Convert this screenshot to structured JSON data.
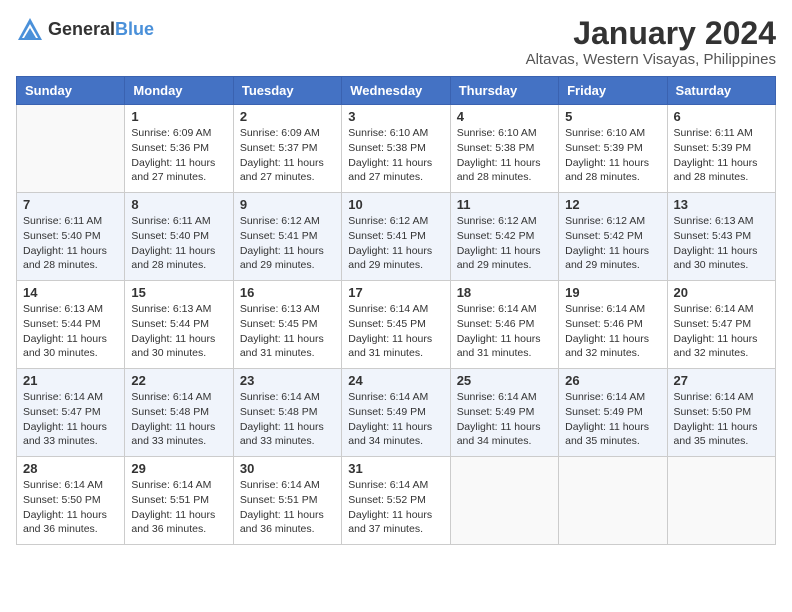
{
  "logo": {
    "general": "General",
    "blue": "Blue"
  },
  "title": "January 2024",
  "location": "Altavas, Western Visayas, Philippines",
  "days_header": [
    "Sunday",
    "Monday",
    "Tuesday",
    "Wednesday",
    "Thursday",
    "Friday",
    "Saturday"
  ],
  "weeks": [
    [
      {
        "day": "",
        "sunrise": "",
        "sunset": "",
        "daylight": ""
      },
      {
        "day": "1",
        "sunrise": "Sunrise: 6:09 AM",
        "sunset": "Sunset: 5:36 PM",
        "daylight": "Daylight: 11 hours and 27 minutes."
      },
      {
        "day": "2",
        "sunrise": "Sunrise: 6:09 AM",
        "sunset": "Sunset: 5:37 PM",
        "daylight": "Daylight: 11 hours and 27 minutes."
      },
      {
        "day": "3",
        "sunrise": "Sunrise: 6:10 AM",
        "sunset": "Sunset: 5:38 PM",
        "daylight": "Daylight: 11 hours and 27 minutes."
      },
      {
        "day": "4",
        "sunrise": "Sunrise: 6:10 AM",
        "sunset": "Sunset: 5:38 PM",
        "daylight": "Daylight: 11 hours and 28 minutes."
      },
      {
        "day": "5",
        "sunrise": "Sunrise: 6:10 AM",
        "sunset": "Sunset: 5:39 PM",
        "daylight": "Daylight: 11 hours and 28 minutes."
      },
      {
        "day": "6",
        "sunrise": "Sunrise: 6:11 AM",
        "sunset": "Sunset: 5:39 PM",
        "daylight": "Daylight: 11 hours and 28 minutes."
      }
    ],
    [
      {
        "day": "7",
        "sunrise": "Sunrise: 6:11 AM",
        "sunset": "Sunset: 5:40 PM",
        "daylight": "Daylight: 11 hours and 28 minutes."
      },
      {
        "day": "8",
        "sunrise": "Sunrise: 6:11 AM",
        "sunset": "Sunset: 5:40 PM",
        "daylight": "Daylight: 11 hours and 28 minutes."
      },
      {
        "day": "9",
        "sunrise": "Sunrise: 6:12 AM",
        "sunset": "Sunset: 5:41 PM",
        "daylight": "Daylight: 11 hours and 29 minutes."
      },
      {
        "day": "10",
        "sunrise": "Sunrise: 6:12 AM",
        "sunset": "Sunset: 5:41 PM",
        "daylight": "Daylight: 11 hours and 29 minutes."
      },
      {
        "day": "11",
        "sunrise": "Sunrise: 6:12 AM",
        "sunset": "Sunset: 5:42 PM",
        "daylight": "Daylight: 11 hours and 29 minutes."
      },
      {
        "day": "12",
        "sunrise": "Sunrise: 6:12 AM",
        "sunset": "Sunset: 5:42 PM",
        "daylight": "Daylight: 11 hours and 29 minutes."
      },
      {
        "day": "13",
        "sunrise": "Sunrise: 6:13 AM",
        "sunset": "Sunset: 5:43 PM",
        "daylight": "Daylight: 11 hours and 30 minutes."
      }
    ],
    [
      {
        "day": "14",
        "sunrise": "Sunrise: 6:13 AM",
        "sunset": "Sunset: 5:44 PM",
        "daylight": "Daylight: 11 hours and 30 minutes."
      },
      {
        "day": "15",
        "sunrise": "Sunrise: 6:13 AM",
        "sunset": "Sunset: 5:44 PM",
        "daylight": "Daylight: 11 hours and 30 minutes."
      },
      {
        "day": "16",
        "sunrise": "Sunrise: 6:13 AM",
        "sunset": "Sunset: 5:45 PM",
        "daylight": "Daylight: 11 hours and 31 minutes."
      },
      {
        "day": "17",
        "sunrise": "Sunrise: 6:14 AM",
        "sunset": "Sunset: 5:45 PM",
        "daylight": "Daylight: 11 hours and 31 minutes."
      },
      {
        "day": "18",
        "sunrise": "Sunrise: 6:14 AM",
        "sunset": "Sunset: 5:46 PM",
        "daylight": "Daylight: 11 hours and 31 minutes."
      },
      {
        "day": "19",
        "sunrise": "Sunrise: 6:14 AM",
        "sunset": "Sunset: 5:46 PM",
        "daylight": "Daylight: 11 hours and 32 minutes."
      },
      {
        "day": "20",
        "sunrise": "Sunrise: 6:14 AM",
        "sunset": "Sunset: 5:47 PM",
        "daylight": "Daylight: 11 hours and 32 minutes."
      }
    ],
    [
      {
        "day": "21",
        "sunrise": "Sunrise: 6:14 AM",
        "sunset": "Sunset: 5:47 PM",
        "daylight": "Daylight: 11 hours and 33 minutes."
      },
      {
        "day": "22",
        "sunrise": "Sunrise: 6:14 AM",
        "sunset": "Sunset: 5:48 PM",
        "daylight": "Daylight: 11 hours and 33 minutes."
      },
      {
        "day": "23",
        "sunrise": "Sunrise: 6:14 AM",
        "sunset": "Sunset: 5:48 PM",
        "daylight": "Daylight: 11 hours and 33 minutes."
      },
      {
        "day": "24",
        "sunrise": "Sunrise: 6:14 AM",
        "sunset": "Sunset: 5:49 PM",
        "daylight": "Daylight: 11 hours and 34 minutes."
      },
      {
        "day": "25",
        "sunrise": "Sunrise: 6:14 AM",
        "sunset": "Sunset: 5:49 PM",
        "daylight": "Daylight: 11 hours and 34 minutes."
      },
      {
        "day": "26",
        "sunrise": "Sunrise: 6:14 AM",
        "sunset": "Sunset: 5:49 PM",
        "daylight": "Daylight: 11 hours and 35 minutes."
      },
      {
        "day": "27",
        "sunrise": "Sunrise: 6:14 AM",
        "sunset": "Sunset: 5:50 PM",
        "daylight": "Daylight: 11 hours and 35 minutes."
      }
    ],
    [
      {
        "day": "28",
        "sunrise": "Sunrise: 6:14 AM",
        "sunset": "Sunset: 5:50 PM",
        "daylight": "Daylight: 11 hours and 36 minutes."
      },
      {
        "day": "29",
        "sunrise": "Sunrise: 6:14 AM",
        "sunset": "Sunset: 5:51 PM",
        "daylight": "Daylight: 11 hours and 36 minutes."
      },
      {
        "day": "30",
        "sunrise": "Sunrise: 6:14 AM",
        "sunset": "Sunset: 5:51 PM",
        "daylight": "Daylight: 11 hours and 36 minutes."
      },
      {
        "day": "31",
        "sunrise": "Sunrise: 6:14 AM",
        "sunset": "Sunset: 5:52 PM",
        "daylight": "Daylight: 11 hours and 37 minutes."
      },
      {
        "day": "",
        "sunrise": "",
        "sunset": "",
        "daylight": ""
      },
      {
        "day": "",
        "sunrise": "",
        "sunset": "",
        "daylight": ""
      },
      {
        "day": "",
        "sunrise": "",
        "sunset": "",
        "daylight": ""
      }
    ]
  ]
}
